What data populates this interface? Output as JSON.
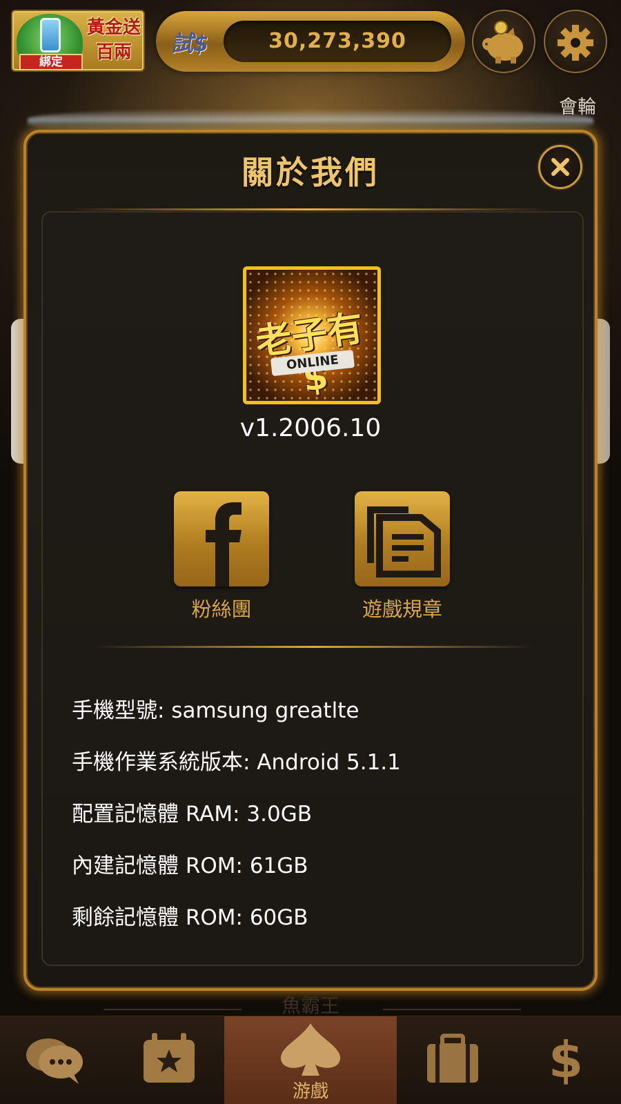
{
  "top_bar": {
    "bind_badge": {
      "ribbon_label": "綁定",
      "promo_text": "黃金送百兩"
    },
    "coin_bar": {
      "currency_label": "試$",
      "balance": "30,273,390"
    },
    "piggy_bank_icon": "piggy-bank-icon",
    "settings_icon": "gear-icon"
  },
  "background": {
    "ticker_text": "會輪",
    "bottom_caption": "魚霸王"
  },
  "modal": {
    "title": "關於我們",
    "close_icon": "close-icon",
    "app_icon": {
      "logo_text": "老子有$",
      "online_text": "ONLINE"
    },
    "version": "v1.2006.10",
    "links": [
      {
        "label": "粉絲團",
        "icon": "facebook-icon"
      },
      {
        "label": "遊戲規章",
        "icon": "documents-icon"
      }
    ],
    "device_info": [
      "手機型號: samsung greatlte",
      "手機作業系統版本: Android 5.1.1",
      "配置記憶體 RAM: 3.0GB",
      "內建記憶體 ROM: 61GB",
      "剩餘記憶體 ROM: 60GB"
    ]
  },
  "bottom_nav": {
    "items": [
      {
        "icon": "chat-bubbles-icon",
        "label": ""
      },
      {
        "icon": "calendar-star-icon",
        "label": ""
      },
      {
        "icon": "spade-icon",
        "label": "游戲",
        "active": true
      },
      {
        "icon": "briefcase-icon",
        "label": ""
      },
      {
        "icon": "dollar-icon",
        "label": ""
      }
    ]
  },
  "colors": {
    "gold_accent": "#f0c46a",
    "modal_border": "#b9832a",
    "active_tab": "#6a3a20"
  }
}
